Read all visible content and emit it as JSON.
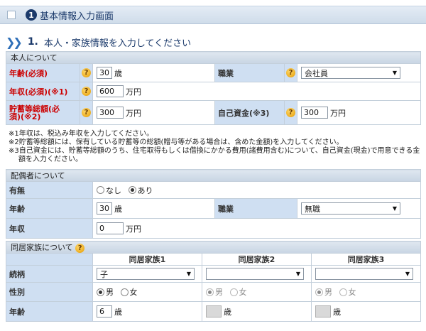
{
  "header": {
    "number": "1",
    "title": "基本情報入力画面"
  },
  "section": {
    "number": "1.",
    "title": "本人・家族情報を入力してください"
  },
  "self": {
    "heading": "本人について",
    "age": {
      "label": "年齢(必須)",
      "value": "30",
      "unit": "歳"
    },
    "occupation": {
      "label": "職業",
      "value": "会社員"
    },
    "income": {
      "label": "年収(必須)(※1)",
      "value": "600",
      "unit": "万円"
    },
    "savings": {
      "label_line1": "貯蓄等総額(必",
      "label_line2": "須)(※2)",
      "value": "300",
      "unit": "万円"
    },
    "own_funds": {
      "label": "自己資金(※3)",
      "value": "300",
      "unit": "万円"
    }
  },
  "notes": [
    "※1年収は、税込み年収を入力してください。",
    "※2貯蓄等総額には、保有している貯蓄等の総額(贈与等がある場合は、含めた金額)を入力してください。",
    "※3自己資金には、貯蓄等総額のうち、住宅取得もしくは借換にかかる費用(諸費用含む)について、自己資金(現金)で用意できる金額を入力ください。"
  ],
  "spouse": {
    "heading": "配偶者について",
    "presence": {
      "label": "有無",
      "option_no": "なし",
      "option_yes": "あり"
    },
    "age": {
      "label": "年齢",
      "value": "30",
      "unit": "歳"
    },
    "occupation": {
      "label": "職業",
      "value": "無職"
    },
    "income": {
      "label": "年収",
      "value": "0",
      "unit": "万円"
    }
  },
  "family": {
    "heading": "同居家族について",
    "columns": [
      "同居家族1",
      "同居家族2",
      "同居家族3"
    ],
    "relation_label": "続柄",
    "gender_label": "性別",
    "age_label": "年齢",
    "male": "男",
    "female": "女",
    "age_unit": "歳",
    "members": [
      {
        "relation": "子",
        "age": "6"
      },
      {
        "relation": "",
        "age": ""
      },
      {
        "relation": "",
        "age": ""
      }
    ]
  },
  "colors": {
    "label_bg": "#cfdff2",
    "required": "#cc0000",
    "accent": "#1b3a6b"
  }
}
